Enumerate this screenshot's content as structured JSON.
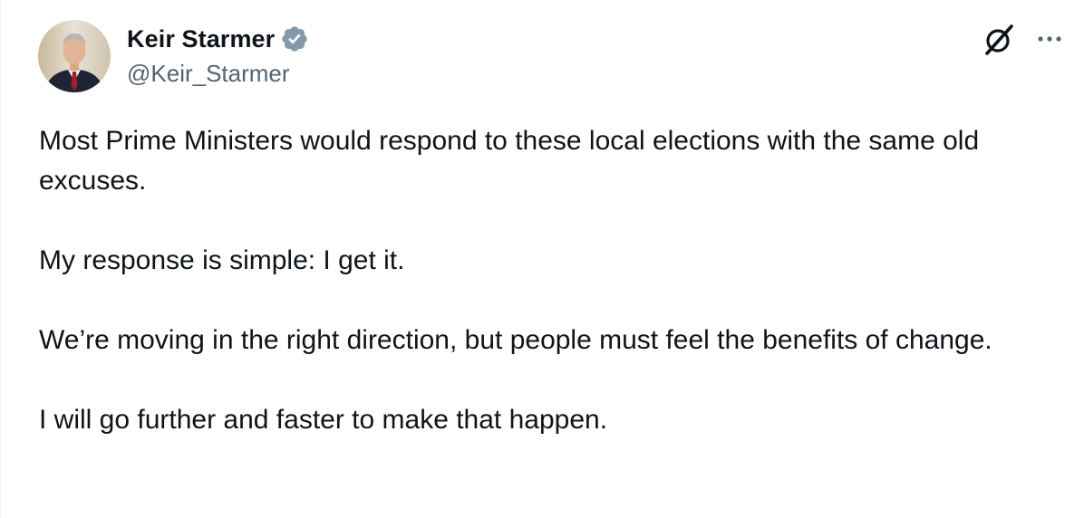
{
  "author": {
    "display_name": "Keir Starmer",
    "handle": "@Keir_Starmer",
    "verified_icon": "verified-badge-icon"
  },
  "actions": {
    "grok_icon": "grok-icon",
    "more_icon": "more-options-icon"
  },
  "tweet": {
    "paragraphs": [
      "Most Prime Ministers would respond to these local elections with the same old excuses.",
      "My response is simple: I get it.",
      "We’re moving in the right direction, but people must feel the benefits of change.",
      "I will go further and faster to make that happen."
    ]
  },
  "colors": {
    "text": "#0f1419",
    "secondary": "#536471",
    "verified_badge": "#829aab"
  }
}
